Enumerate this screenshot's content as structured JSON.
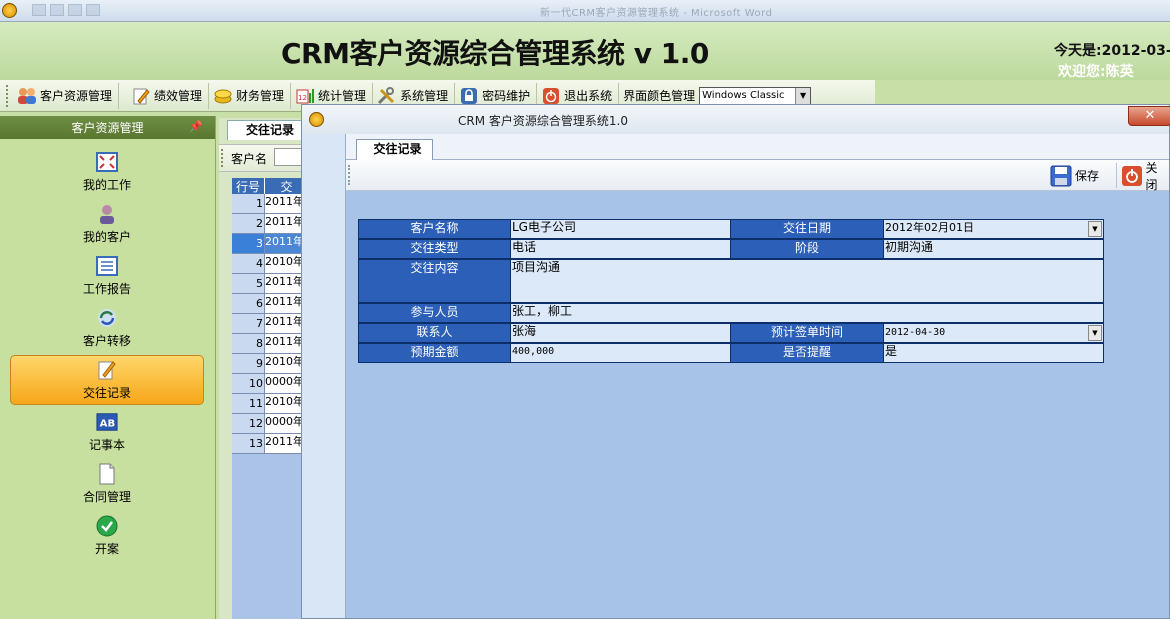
{
  "outer": {
    "faded_title": "新一代CRM客户资源管理系统 - Microsoft Word"
  },
  "header": {
    "title": "CRM客户资源综合管理系统 v 1.0",
    "today": "今天是:2012-03-3",
    "welcome": "欢迎您:陈英"
  },
  "toolbar": {
    "items": [
      {
        "label": "客户资源管理",
        "icon": "users-icon"
      },
      {
        "label": "绩效管理",
        "icon": "pencil-icon"
      },
      {
        "label": "财务管理",
        "icon": "coins-icon"
      },
      {
        "label": "统计管理",
        "icon": "calendar-chart-icon"
      },
      {
        "label": "系统管理",
        "icon": "tools-icon"
      },
      {
        "label": "密码维护",
        "icon": "lock-icon"
      },
      {
        "label": "退出系统",
        "icon": "power-icon"
      }
    ],
    "theme_label": "界面颜色管理",
    "theme_value": "Windows Classic"
  },
  "sidebar": {
    "title": "客户资源管理",
    "items": [
      {
        "label": "我的工作",
        "icon": "expand-icon"
      },
      {
        "label": "我的客户",
        "icon": "person-icon"
      },
      {
        "label": "工作报告",
        "icon": "list-icon"
      },
      {
        "label": "客户转移",
        "icon": "refresh-icon"
      },
      {
        "label": "交往记录",
        "icon": "pencil-note-icon"
      },
      {
        "label": "记事本",
        "icon": "ab-icon"
      },
      {
        "label": "合同管理",
        "icon": "document-icon"
      },
      {
        "label": "开案",
        "icon": "check-icon"
      }
    ]
  },
  "bg_panel": {
    "tab": "交往记录",
    "search_label": "客户名",
    "columns": [
      "行号",
      "交"
    ],
    "rows": [
      {
        "n": "1",
        "d": "2011年"
      },
      {
        "n": "2",
        "d": "2011年"
      },
      {
        "n": "3",
        "d": "2011年"
      },
      {
        "n": "4",
        "d": "2010年"
      },
      {
        "n": "5",
        "d": "2011年"
      },
      {
        "n": "6",
        "d": "2011年"
      },
      {
        "n": "7",
        "d": "2011年"
      },
      {
        "n": "8",
        "d": "2011年"
      },
      {
        "n": "9",
        "d": "2010年"
      },
      {
        "n": "10",
        "d": "0000年"
      },
      {
        "n": "11",
        "d": "2010年"
      },
      {
        "n": "12",
        "d": "0000年"
      },
      {
        "n": "13",
        "d": "2011年"
      }
    ]
  },
  "window": {
    "title": "CRM 客户资源综合管理系统1.0",
    "close": "✕",
    "tab": "交往记录",
    "save": "保存",
    "close_btn": "关闭",
    "form": {
      "customer_label": "客户名称",
      "customer_value": "LG电子公司",
      "date_label": "交往日期",
      "date_value": "2012年02月01日",
      "type_label": "交往类型",
      "type_value": "电话",
      "stage_label": "阶段",
      "stage_value": "初期沟通",
      "content_label": "交往内容",
      "content_value": "项目沟通",
      "participants_label": "参与人员",
      "participants_value": "张工，柳工",
      "contact_label": "联系人",
      "contact_value": "张海",
      "sign_label": "预计签单时间",
      "sign_value": "2012-04-30",
      "amount_label": "预期金额",
      "amount_value": "400,000",
      "remind_label": "是否提醒",
      "remind_value": "是"
    }
  }
}
